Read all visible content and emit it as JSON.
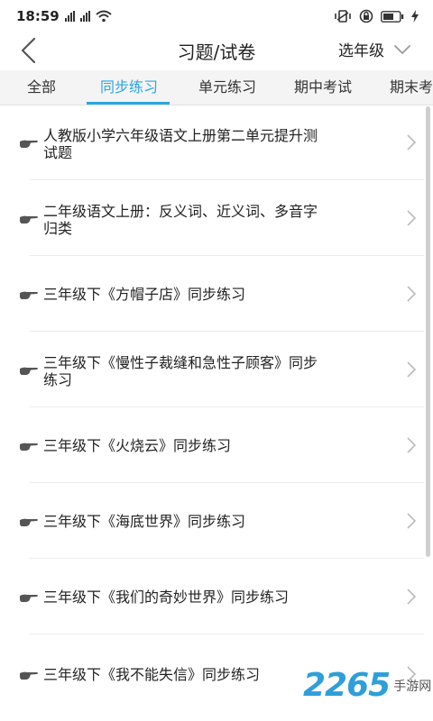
{
  "status_bar": {
    "time": "18:59",
    "network_1": "HD",
    "network_2": "HD",
    "icons": [
      "signal-icon",
      "wifi-icon",
      "vibrate-icon",
      "alarm-icon",
      "battery-icon",
      "charging-icon"
    ]
  },
  "nav": {
    "title": "习题/试卷",
    "grade_select": "选年级"
  },
  "tabs": [
    {
      "label": "全部"
    },
    {
      "label": "同步练习",
      "active": true
    },
    {
      "label": "单元练习"
    },
    {
      "label": "期中考试"
    },
    {
      "label": "期末考"
    }
  ],
  "items": [
    {
      "line1": "人教版小学六年级语文上册第二单元提升测",
      "line2": "试题"
    },
    {
      "line1": "二年级语文上册：反义词、近义词、多音字",
      "line2": "归类"
    },
    {
      "line1": "三年级下《方帽子店》同步练习",
      "line2": ""
    },
    {
      "line1": "三年级下《慢性子裁缝和急性子顾客》同步",
      "line2": "练习"
    },
    {
      "line1": "三年级下《火烧云》同步练习",
      "line2": ""
    },
    {
      "line1": "三年级下《海底世界》同步练习",
      "line2": ""
    },
    {
      "line1": "三年级下《我们的奇妙世界》同步练习",
      "line2": ""
    },
    {
      "line1": "三年级下《我不能失信》同步练习",
      "line2": ""
    }
  ],
  "watermark": {
    "number": "2265",
    "text": "手游网"
  },
  "colors": {
    "accent": "#2aa6e0",
    "watermark": "#2f9fd8"
  }
}
